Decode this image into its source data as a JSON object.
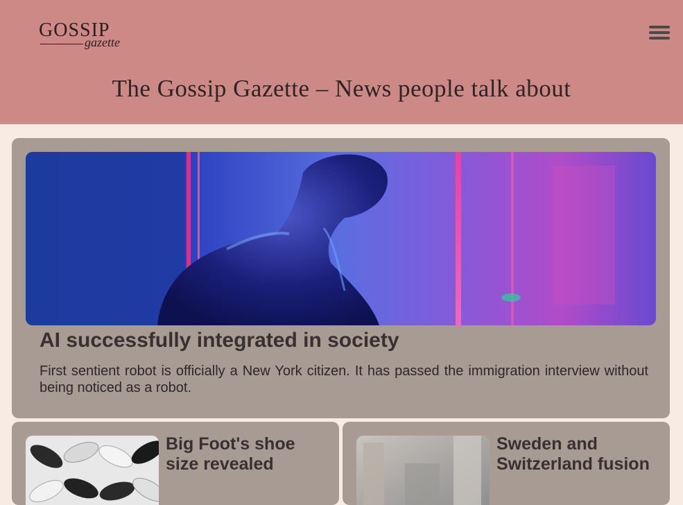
{
  "header": {
    "logo_main": "GOSSIP",
    "logo_sub": "gazette",
    "title": "The Gossip Gazette – News people talk about"
  },
  "featured": {
    "headline": "AI successfully integrated in society",
    "summary": "First sentient robot is officially a New York citizen. It has passed the immigration interview without being noticed as a robot."
  },
  "articles": [
    {
      "title": "Big Foot's shoe size revealed"
    },
    {
      "title": "Sweden and Switzerland fusion"
    }
  ],
  "colors": {
    "header_bg": "#cd8985",
    "page_bg": "#f8ebe4",
    "card_bg": "#a89b94"
  }
}
